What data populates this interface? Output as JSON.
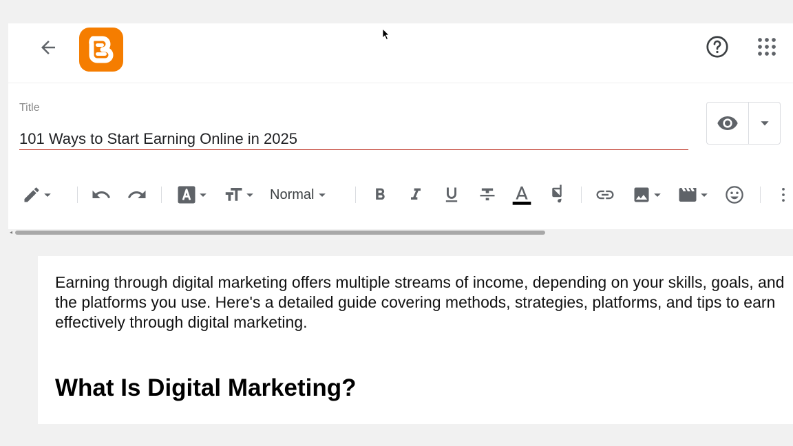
{
  "colors": {
    "brand": "#f57d00",
    "title_underline": "#c0392b",
    "icon": "#5f6368"
  },
  "header": {
    "back_icon": "arrow-back-icon",
    "logo_icon": "blogger-logo-icon",
    "help_icon": "help-circle-icon",
    "apps_icon": "apps-grid-icon"
  },
  "title": {
    "label": "Title",
    "value": "101 Ways to Start Earning Online in 2025"
  },
  "preview": {
    "icon": "eye-icon",
    "dropdown_icon": "caret-down-icon"
  },
  "toolbar": {
    "format_label": "Normal",
    "items": [
      "pencil-icon",
      "undo-icon",
      "redo-icon",
      "font-icon",
      "text-size-icon",
      "bold-icon",
      "italic-icon",
      "underline-icon",
      "strikethrough-icon",
      "text-color-icon",
      "highlight-icon",
      "link-icon",
      "image-icon",
      "video-icon",
      "emoji-icon",
      "more-vert-icon"
    ]
  },
  "editor": {
    "paragraph": "Earning through digital marketing offers multiple streams of income, depending on your skills, goals, and the platforms you use. Here's a detailed guide covering methods, strategies, platforms, and tips to earn effectively through digital marketing.",
    "heading": "What Is Digital Marketing?"
  }
}
